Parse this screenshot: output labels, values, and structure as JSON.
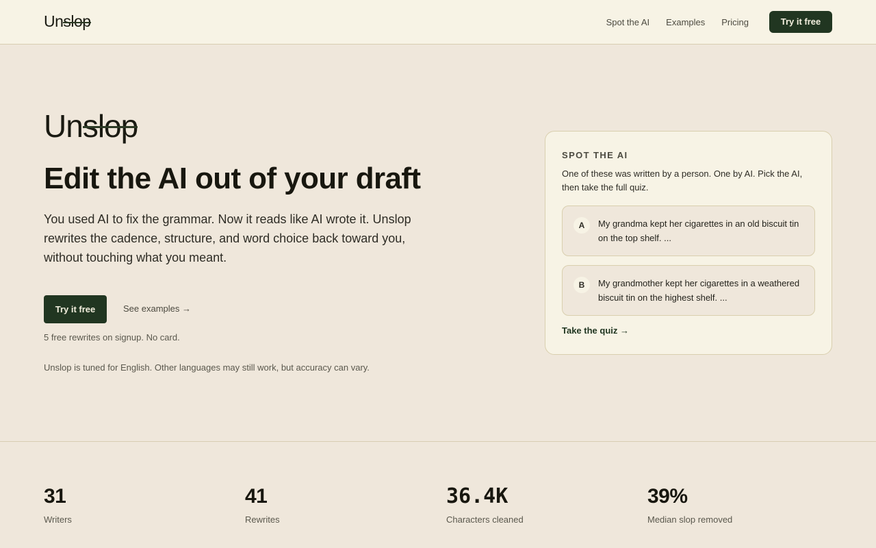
{
  "nav": {
    "logo_prefix": "Un",
    "logo_struck": "slop",
    "links": [
      "Spot the AI",
      "Examples",
      "Pricing"
    ],
    "cta": "Try it free"
  },
  "hero": {
    "logo_prefix": "Un",
    "logo_struck": "slop",
    "title": "Edit the AI out of your draft",
    "description": "You used AI to fix the grammar. Now it reads like AI wrote it. Unslop rewrites the cadence, structure, and word choice back toward you, without touching what you meant.",
    "cta": "Try it free",
    "examples_link": "See examples →",
    "note": "5 free rewrites on signup. No card.",
    "language_note": "Unslop is tuned for English. Other languages may still work, but accuracy can vary."
  },
  "spot": {
    "eyebrow": "SPOT THE AI",
    "intro": "One of these was written by a person. One by AI. Pick the AI, then take the full quiz.",
    "choices": [
      {
        "badge": "A",
        "text": "My grandma kept her cigarettes in an old biscuit tin on the top shelf. ..."
      },
      {
        "badge": "B",
        "text": "My grandmother kept her cigarettes in a weathered biscuit tin on the highest shelf. ..."
      }
    ],
    "link": "Take the quiz →"
  },
  "stats": [
    {
      "value": "31",
      "label": "Writers"
    },
    {
      "value": "41",
      "label": "Rewrites"
    },
    {
      "value": "36.4K",
      "label": "Characters cleaned"
    },
    {
      "value": "39%",
      "label": "Median slop removed"
    }
  ]
}
